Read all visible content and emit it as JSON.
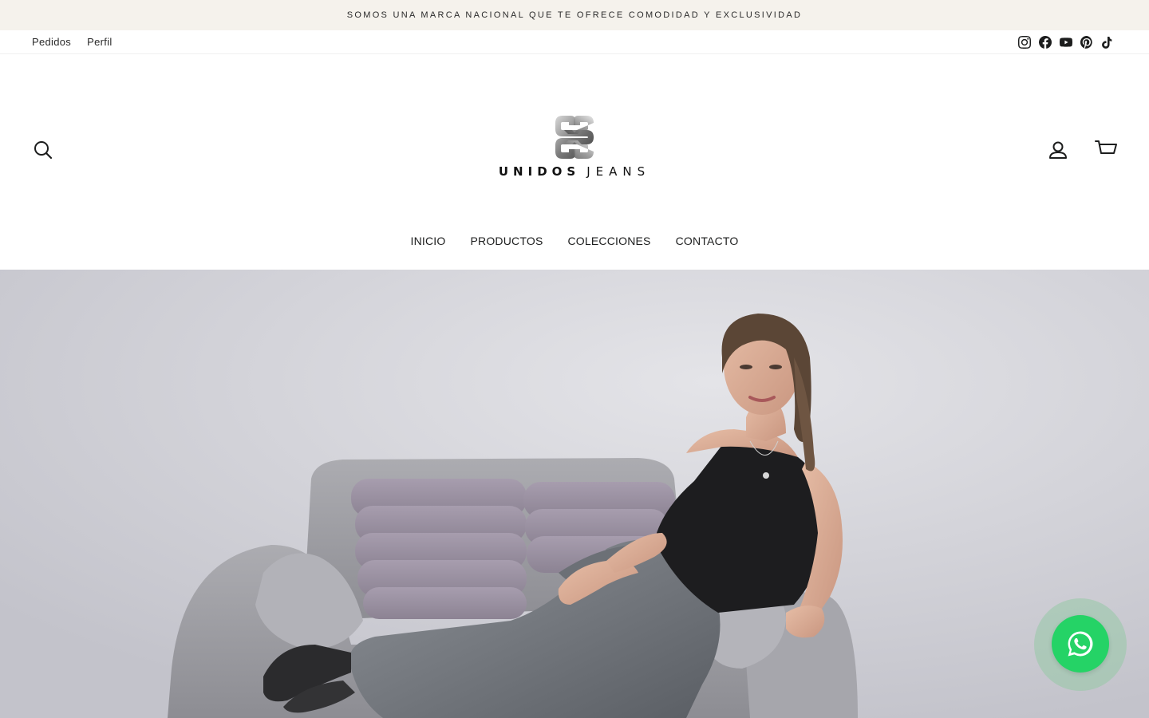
{
  "announcement": {
    "text": "SOMOS UNA MARCA NACIONAL QUE TE OFRECE COMODIDAD Y EXCLUSIVIDAD"
  },
  "utility_bar": {
    "links": [
      "Pedidos",
      "Perfil"
    ],
    "social_icons": [
      "instagram-icon",
      "facebook-icon",
      "youtube-icon",
      "pinterest-icon",
      "tiktok-icon"
    ]
  },
  "header": {
    "logo": {
      "word1": "UNIDOS",
      "word2": "JEANS"
    },
    "icons": [
      "search-icon",
      "user-icon",
      "cart-icon"
    ]
  },
  "nav": {
    "items": [
      "INICIO",
      "PRODUCTOS",
      "COLECCIONES",
      "CONTACTO"
    ]
  },
  "hero": {
    "image": "banner photo: woman in black top and grey jeans on a grey sofa"
  },
  "floating": {
    "icon": "whatsapp-icon",
    "color": "#25d366"
  },
  "colors": {
    "announcement_bg": "#f5f2ec",
    "text": "#1c1d1d",
    "hero_bg": "#d4d4da"
  }
}
